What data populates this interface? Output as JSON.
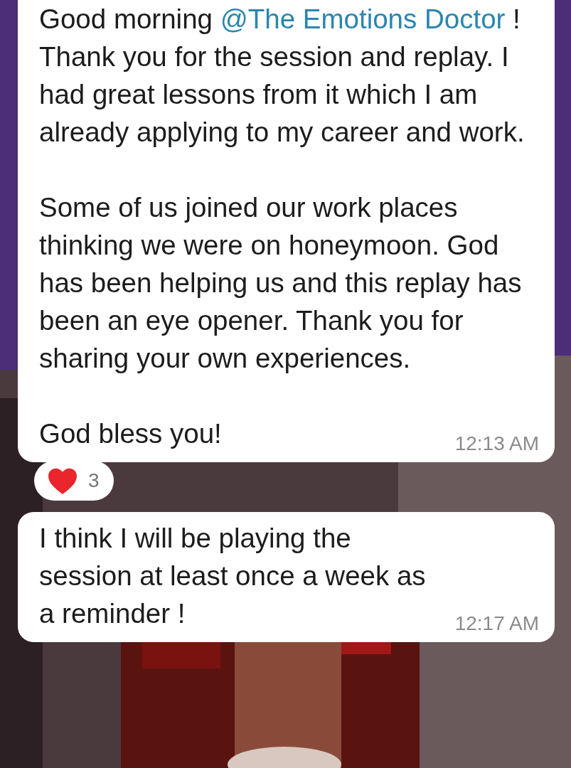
{
  "messages": [
    {
      "paragraphs": [
        {
          "before": "Good morning ",
          "mention": "@The Emotions Doctor",
          "after": " ! Thank you for the session and replay. I had great lessons from it which I am already applying to my career and work."
        },
        {
          "text": "Some of us joined our work places thinking we were on honeymoon. God has been helping us and this replay has been an eye opener. Thank you for sharing your own experiences."
        },
        {
          "text": "God bless you!"
        }
      ],
      "time": "12:13 AM",
      "reactions": [
        {
          "count": "3"
        }
      ]
    },
    {
      "paragraphs": [
        {
          "text": "I think I will be playing the session at least once a week as a reminder !"
        }
      ],
      "time": "12:17 AM"
    }
  ]
}
